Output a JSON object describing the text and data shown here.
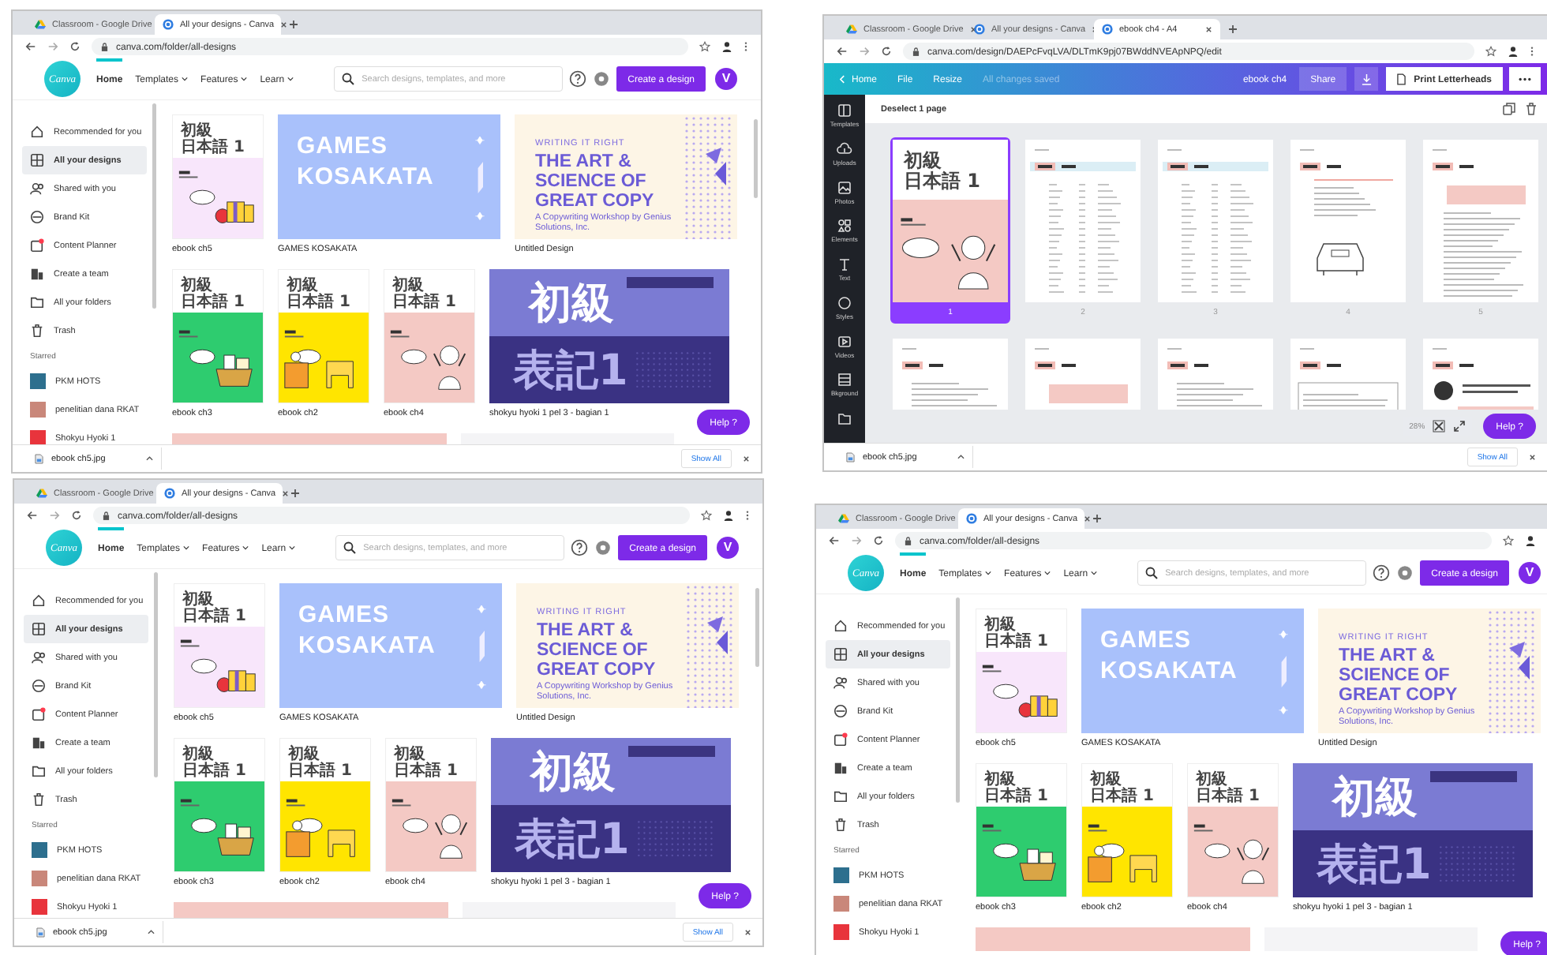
{
  "windows": [
    {
      "kind": "home",
      "browser_tabs": [
        {
          "title": "Classroom - Google Drive",
          "selected": false
        },
        {
          "title": "All your designs - Canva",
          "selected": true
        }
      ],
      "url": "canva.com/folder/all-designs",
      "logo": "Canva",
      "nav": [
        {
          "label": "Home",
          "selected": true,
          "dropdown": false
        },
        {
          "label": "Templates",
          "selected": false,
          "dropdown": true
        },
        {
          "label": "Features",
          "selected": false,
          "dropdown": true
        },
        {
          "label": "Learn",
          "selected": false,
          "dropdown": true
        }
      ],
      "search": {
        "placeholder": "Search designs, templates, and more"
      },
      "create_button": "Create a design",
      "avatar": "V",
      "sidebar": [
        {
          "label": "Recommended for you",
          "kind": "home",
          "selected": false
        },
        {
          "label": "All your designs",
          "kind": "designs",
          "selected": true
        },
        {
          "label": "Shared with you",
          "kind": "shared",
          "selected": false
        },
        {
          "label": "Brand Kit",
          "kind": "brand",
          "selected": false
        },
        {
          "label": "Content Planner",
          "kind": "planner",
          "selected": false
        },
        {
          "label": "Create a team",
          "kind": "team",
          "selected": false
        },
        {
          "label": "All your folders",
          "kind": "folders",
          "selected": false
        },
        {
          "label": "Trash",
          "kind": "trash",
          "selected": false
        }
      ],
      "starred_heading": "Starred",
      "starred": [
        {
          "label": "PKM HOTS",
          "color": "#2d6f8e"
        },
        {
          "label": "penelitian dana RKAT",
          "color": "#c9877a"
        },
        {
          "label": "Shokyu Hyoki 1",
          "color": "#e8343c"
        }
      ],
      "design_rows": [
        [
          {
            "kind": "book",
            "title_lines": [
              "初級",
              "日本語 1"
            ],
            "color": "#f8e6fb",
            "illustration": {
              "kind": "gift"
            },
            "label": "ebook ch5"
          },
          {
            "kind": "games",
            "title_lines": [
              "GAMES",
              "KOSAKATA"
            ],
            "label": "GAMES KOSAKATA"
          },
          {
            "kind": "copy",
            "kicker": "WRITING IT RIGHT",
            "title_lines": [
              "THE ART &",
              "SCIENCE OF",
              "GREAT COPY"
            ],
            "subtitle": "A Copywriting Workshop by Genius Solutions, Inc.",
            "label": "Untitled Design"
          }
        ],
        [
          {
            "kind": "book",
            "title_lines": [
              "初級",
              "日本語 1"
            ],
            "color": "#2ecc6f",
            "illustration": {
              "kind": "basket"
            },
            "label": "ebook ch3"
          },
          {
            "kind": "book",
            "title_lines": [
              "初級",
              "日本語 1"
            ],
            "color": "#ffe500",
            "illustration": {
              "kind": "furniture"
            },
            "label": "ebook ch2"
          },
          {
            "kind": "book",
            "title_lines": [
              "初級",
              "日本語 1"
            ],
            "color": "#f4c9c4",
            "illustration": {
              "kind": "girl"
            },
            "label": "ebook ch4"
          },
          {
            "kind": "kanji",
            "title_lines": [
              "初級",
              "表記1"
            ],
            "label": "shokyu hyoki 1 pel 3 - bagian 1"
          }
        ]
      ],
      "partial_row": [
        {
          "color": "#f4c9c4"
        },
        {
          "color": "#f4f4f6"
        }
      ],
      "help": "Help ?",
      "download": {
        "file": "ebook ch5.jpg",
        "show_all": "Show All"
      }
    },
    {
      "kind": "editor",
      "browser_tabs": [
        {
          "title": "Classroom - Google Drive",
          "selected": false
        },
        {
          "title": "All your designs - Canva",
          "selected": false
        },
        {
          "title": "ebook ch4 - A4",
          "selected": true
        }
      ],
      "url": "canva.com/design/DAEPcFvqLVA/DLTmK9pj07BWddNVEApNPQ/edit",
      "topbar": {
        "home": "Home",
        "menu": [
          "File",
          "Resize"
        ],
        "status": "All changes saved",
        "doc_title": "ebook ch4",
        "share": "Share",
        "print": "Print Letterheads"
      },
      "tools": [
        {
          "label": "Templates",
          "kind": "templates"
        },
        {
          "label": "Uploads",
          "kind": "uploads"
        },
        {
          "label": "Photos",
          "kind": "photos"
        },
        {
          "label": "Elements",
          "kind": "elements"
        },
        {
          "label": "Text",
          "kind": "text"
        },
        {
          "label": "Styles",
          "kind": "styles"
        },
        {
          "label": "Videos",
          "kind": "videos"
        },
        {
          "label": "Bkground",
          "kind": "background"
        },
        {
          "kind": "folder"
        }
      ],
      "deselect": "Deselect 1 page",
      "page_rows": [
        [
          {
            "kind": "cover",
            "number": "1",
            "selected": true,
            "title_lines": [
              "初級",
              "日本語 1"
            ],
            "color": "#f4c9c4"
          },
          {
            "kind": "list",
            "number": "2",
            "selected": false
          },
          {
            "kind": "list",
            "number": "3",
            "selected": false
          },
          {
            "kind": "car",
            "number": "4",
            "selected": false
          },
          {
            "kind": "text",
            "number": "5",
            "selected": false
          }
        ],
        [
          {
            "kind": "plain",
            "selected": false
          },
          {
            "kind": "text",
            "selected": false
          },
          {
            "kind": "plain",
            "selected": false
          },
          {
            "kind": "map",
            "selected": false
          },
          {
            "kind": "figure",
            "selected": false
          }
        ]
      ],
      "zoom": "28%",
      "help": "Help ?",
      "download": {
        "file": "ebook ch5.jpg",
        "show_all": "Show All"
      }
    },
    {
      "kind": "home",
      "browser_tabs": [
        {
          "title": "Classroom - Google Drive",
          "selected": false
        },
        {
          "title": "All your designs - Canva",
          "selected": true
        }
      ],
      "url": "canva.com/folder/all-designs",
      "logo": "Canva",
      "nav": [
        {
          "label": "Home",
          "selected": true,
          "dropdown": false
        },
        {
          "label": "Templates",
          "selected": false,
          "dropdown": true
        },
        {
          "label": "Features",
          "selected": false,
          "dropdown": true
        },
        {
          "label": "Learn",
          "selected": false,
          "dropdown": true
        }
      ],
      "search": {
        "placeholder": "Search designs, templates, and more"
      },
      "create_button": "Create a design",
      "avatar": "V",
      "sidebar": [
        {
          "label": "Recommended for you",
          "kind": "home",
          "selected": false
        },
        {
          "label": "All your designs",
          "kind": "designs",
          "selected": true
        },
        {
          "label": "Shared with you",
          "kind": "shared",
          "selected": false
        },
        {
          "label": "Brand Kit",
          "kind": "brand",
          "selected": false
        },
        {
          "label": "Content Planner",
          "kind": "planner",
          "selected": false
        },
        {
          "label": "Create a team",
          "kind": "team",
          "selected": false
        },
        {
          "label": "All your folders",
          "kind": "folders",
          "selected": false
        },
        {
          "label": "Trash",
          "kind": "trash",
          "selected": false
        }
      ],
      "starred_heading": "Starred",
      "starred": [
        {
          "label": "PKM HOTS",
          "color": "#2d6f8e"
        },
        {
          "label": "penelitian dana RKAT",
          "color": "#c9877a"
        },
        {
          "label": "Shokyu Hyoki 1",
          "color": "#e8343c"
        }
      ],
      "design_rows": [
        [
          {
            "kind": "book",
            "title_lines": [
              "初級",
              "日本語 1"
            ],
            "color": "#f8e6fb",
            "illustration": {
              "kind": "gift"
            },
            "label": "ebook ch5"
          },
          {
            "kind": "games",
            "title_lines": [
              "GAMES",
              "KOSAKATA"
            ],
            "label": "GAMES KOSAKATA"
          },
          {
            "kind": "copy",
            "kicker": "WRITING IT RIGHT",
            "title_lines": [
              "THE ART &",
              "SCIENCE OF",
              "GREAT COPY"
            ],
            "subtitle": "A Copywriting Workshop by Genius Solutions, Inc.",
            "label": "Untitled Design"
          }
        ],
        [
          {
            "kind": "book",
            "title_lines": [
              "初級",
              "日本語 1"
            ],
            "color": "#2ecc6f",
            "illustration": {
              "kind": "basket"
            },
            "label": "ebook ch3"
          },
          {
            "kind": "book",
            "title_lines": [
              "初級",
              "日本語 1"
            ],
            "color": "#ffe500",
            "illustration": {
              "kind": "furniture"
            },
            "label": "ebook ch2"
          },
          {
            "kind": "book",
            "title_lines": [
              "初級",
              "日本語 1"
            ],
            "color": "#f4c9c4",
            "illustration": {
              "kind": "girl"
            },
            "label": "ebook ch4"
          },
          {
            "kind": "kanji",
            "title_lines": [
              "初級",
              "表記1"
            ],
            "label": "shokyu hyoki 1 pel 3 - bagian 1"
          }
        ]
      ],
      "partial_row": [
        {
          "color": "#f4c9c4"
        },
        {
          "color": "#f4f4f6"
        }
      ],
      "help": "Help ?",
      "download": {
        "file": "ebook ch5.jpg",
        "show_all": "Show All"
      }
    },
    {
      "kind": "home",
      "browser_tabs": [
        {
          "title": "Classroom - Google Drive",
          "selected": false
        },
        {
          "title": "All your designs - Canva",
          "selected": true
        }
      ],
      "url": "canva.com/folder/all-designs",
      "logo": "Canva",
      "nav": [
        {
          "label": "Home",
          "selected": true,
          "dropdown": false
        },
        {
          "label": "Templates",
          "selected": false,
          "dropdown": true
        },
        {
          "label": "Features",
          "selected": false,
          "dropdown": true
        },
        {
          "label": "Learn",
          "selected": false,
          "dropdown": true
        }
      ],
      "search": {
        "placeholder": "Search designs, templates, and more"
      },
      "create_button": "Create a design",
      "avatar": "V",
      "sidebar": [
        {
          "label": "Recommended for you",
          "kind": "home",
          "selected": false
        },
        {
          "label": "All your designs",
          "kind": "designs",
          "selected": true
        },
        {
          "label": "Shared with you",
          "kind": "shared",
          "selected": false
        },
        {
          "label": "Brand Kit",
          "kind": "brand",
          "selected": false
        },
        {
          "label": "Content Planner",
          "kind": "planner",
          "selected": false
        },
        {
          "label": "Create a team",
          "kind": "team",
          "selected": false
        },
        {
          "label": "All your folders",
          "kind": "folders",
          "selected": false
        },
        {
          "label": "Trash",
          "kind": "trash",
          "selected": false
        }
      ],
      "starred_heading": "Starred",
      "starred": [
        {
          "label": "PKM HOTS",
          "color": "#2d6f8e"
        },
        {
          "label": "penelitian dana RKAT",
          "color": "#c9877a"
        },
        {
          "label": "Shokyu Hyoki 1",
          "color": "#e8343c"
        }
      ],
      "design_rows": [
        [
          {
            "kind": "book",
            "title_lines": [
              "初級",
              "日本語 1"
            ],
            "color": "#f8e6fb",
            "illustration": {
              "kind": "gift"
            },
            "label": "ebook ch5"
          },
          {
            "kind": "games",
            "title_lines": [
              "GAMES",
              "KOSAKATA"
            ],
            "label": "GAMES KOSAKATA"
          },
          {
            "kind": "copy",
            "kicker": "WRITING IT RIGHT",
            "title_lines": [
              "THE ART &",
              "SCIENCE OF",
              "GREAT COPY"
            ],
            "subtitle": "A Copywriting Workshop by Genius Solutions, Inc.",
            "label": "Untitled Design"
          }
        ],
        [
          {
            "kind": "book",
            "title_lines": [
              "初級",
              "日本語 1"
            ],
            "color": "#2ecc6f",
            "illustration": {
              "kind": "basket"
            },
            "label": "ebook ch3"
          },
          {
            "kind": "book",
            "title_lines": [
              "初級",
              "日本語 1"
            ],
            "color": "#ffe500",
            "illustration": {
              "kind": "furniture"
            },
            "label": "ebook ch2"
          },
          {
            "kind": "book",
            "title_lines": [
              "初級",
              "日本語 1"
            ],
            "color": "#f4c9c4",
            "illustration": {
              "kind": "girl"
            },
            "label": "ebook ch4"
          },
          {
            "kind": "kanji",
            "title_lines": [
              "初級",
              "表記1"
            ],
            "label": "shokyu hyoki 1 pel 3 - bagian 1"
          }
        ]
      ],
      "partial_row": [
        {
          "color": "#f4c9c4"
        },
        {
          "color": "#f4f4f6"
        }
      ],
      "help": "Help ?"
    }
  ]
}
